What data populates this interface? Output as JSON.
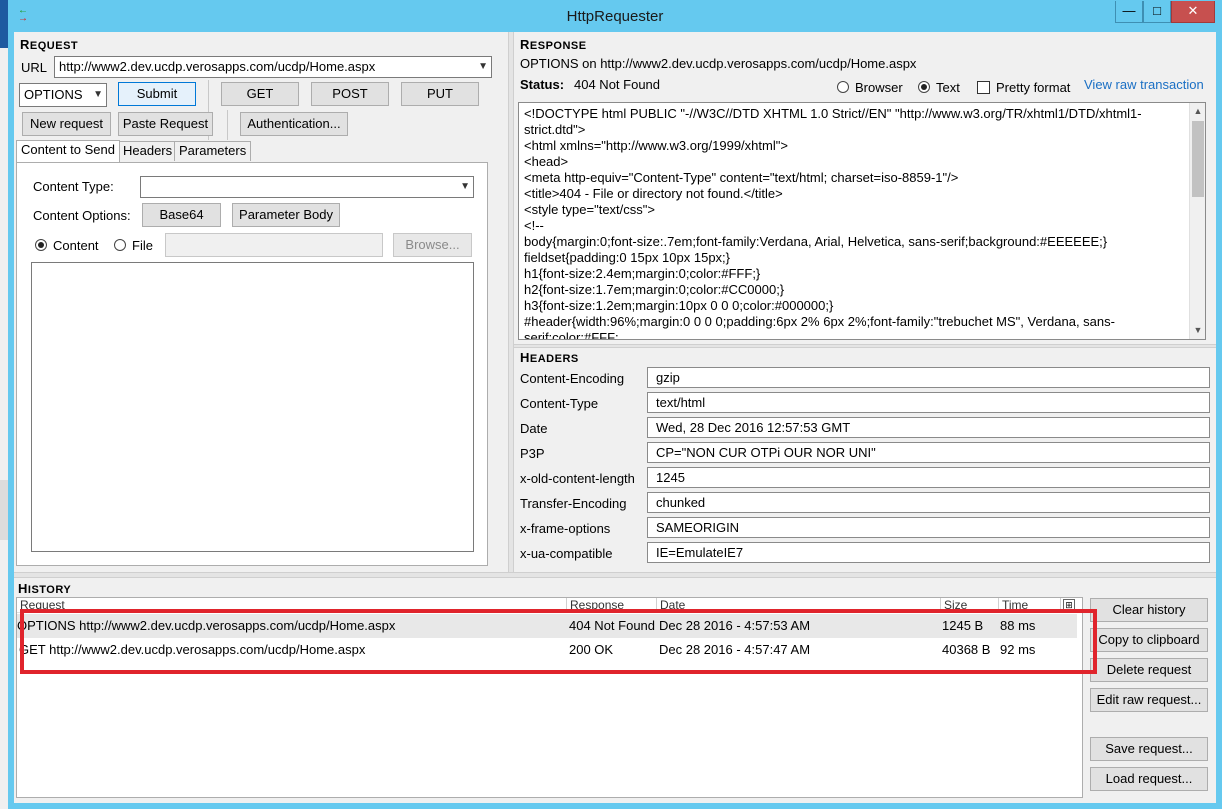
{
  "window": {
    "title": "HttpRequester"
  },
  "request": {
    "section_title_first": "R",
    "section_title_rest": "EQUEST",
    "url_label": "URL",
    "url_value": "http://www2.dev.ucdp.verosapps.com/ucdp/Home.aspx",
    "method": "OPTIONS",
    "submit_label": "Submit",
    "get_label": "GET",
    "post_label": "POST",
    "put_label": "PUT",
    "new_request_label": "New request",
    "paste_request_label": "Paste Request",
    "authentication_label": "Authentication...",
    "tabs": [
      "Content to Send",
      "Headers",
      "Parameters"
    ],
    "content_type_label": "Content Type:",
    "content_type_value": "",
    "content_options_label": "Content Options:",
    "base64_label": "Base64",
    "parameter_body_label": "Parameter Body",
    "content_radio_label": "Content",
    "file_radio_label": "File",
    "browse_label": "Browse..."
  },
  "response": {
    "section_title_first": "R",
    "section_title_rest": "ESPONSE",
    "summary": "OPTIONS on http://www2.dev.ucdp.verosapps.com/ucdp/Home.aspx",
    "status_label": "Status:",
    "status_value": "404 Not Found",
    "browser_label": "Browser",
    "text_label": "Text",
    "pretty_format_label": "Pretty format",
    "view_raw_label": "View raw transaction",
    "raw_body": "<!DOCTYPE html PUBLIC \"-//W3C//DTD XHTML 1.0 Strict//EN\" \"http://www.w3.org/TR/xhtml1/DTD/xhtml1-strict.dtd\">\n<html xmlns=\"http://www.w3.org/1999/xhtml\">\n<head>\n<meta http-equiv=\"Content-Type\" content=\"text/html; charset=iso-8859-1\"/>\n<title>404 - File or directory not found.</title>\n<style type=\"text/css\">\n<!--\nbody{margin:0;font-size:.7em;font-family:Verdana, Arial, Helvetica, sans-serif;background:#EEEEEE;}\nfieldset{padding:0 15px 10px 15px;}\nh1{font-size:2.4em;margin:0;color:#FFF;}\nh2{font-size:1.7em;margin:0;color:#CC0000;}\nh3{font-size:1.2em;margin:10px 0 0 0;color:#000000;}\n#header{width:96%;margin:0 0 0 0;padding:6px 2% 6px 2%;font-family:\"trebuchet MS\", Verdana, sans-serif;color:#FFF;"
  },
  "headers": {
    "section_title_first": "H",
    "section_title_rest": "EADERS",
    "rows": [
      {
        "name": "Content-Encoding",
        "value": "gzip"
      },
      {
        "name": "Content-Type",
        "value": "text/html"
      },
      {
        "name": "Date",
        "value": "Wed, 28 Dec 2016 12:57:53 GMT"
      },
      {
        "name": "P3P",
        "value": "CP=\"NON CUR OTPi OUR NOR UNI\""
      },
      {
        "name": "x-old-content-length",
        "value": "1245"
      },
      {
        "name": "Transfer-Encoding",
        "value": "chunked"
      },
      {
        "name": "x-frame-options",
        "value": "SAMEORIGIN"
      },
      {
        "name": "x-ua-compatible",
        "value": "IE=EmulateIE7"
      }
    ]
  },
  "history": {
    "section_title_first": "H",
    "section_title_rest": "ISTORY",
    "columns": [
      "Request",
      "Response",
      "Date",
      "Size",
      "Time"
    ],
    "rows": [
      {
        "request": "OPTIONS http://www2.dev.ucdp.verosapps.com/ucdp/Home.aspx",
        "response": "404 Not Found",
        "date": "Dec 28 2016 - 4:57:53 AM",
        "size": "1245 B",
        "time": "88 ms"
      },
      {
        "request": "GET http://www2.dev.ucdp.verosapps.com/ucdp/Home.aspx",
        "response": "200 OK",
        "date": "Dec 28 2016 - 4:57:47 AM",
        "size": "40368 B",
        "time": "92 ms"
      }
    ],
    "clear_label": "Clear history",
    "copy_label": "Copy to clipboard",
    "delete_label": "Delete request",
    "edit_raw_label": "Edit raw request...",
    "save_label": "Save request...",
    "load_label": "Load request..."
  },
  "colors": {
    "title_bar": "#65c9ef",
    "close_button": "#c7504f",
    "highlight_box": "#e0242c",
    "link": "#1a6fc4"
  }
}
